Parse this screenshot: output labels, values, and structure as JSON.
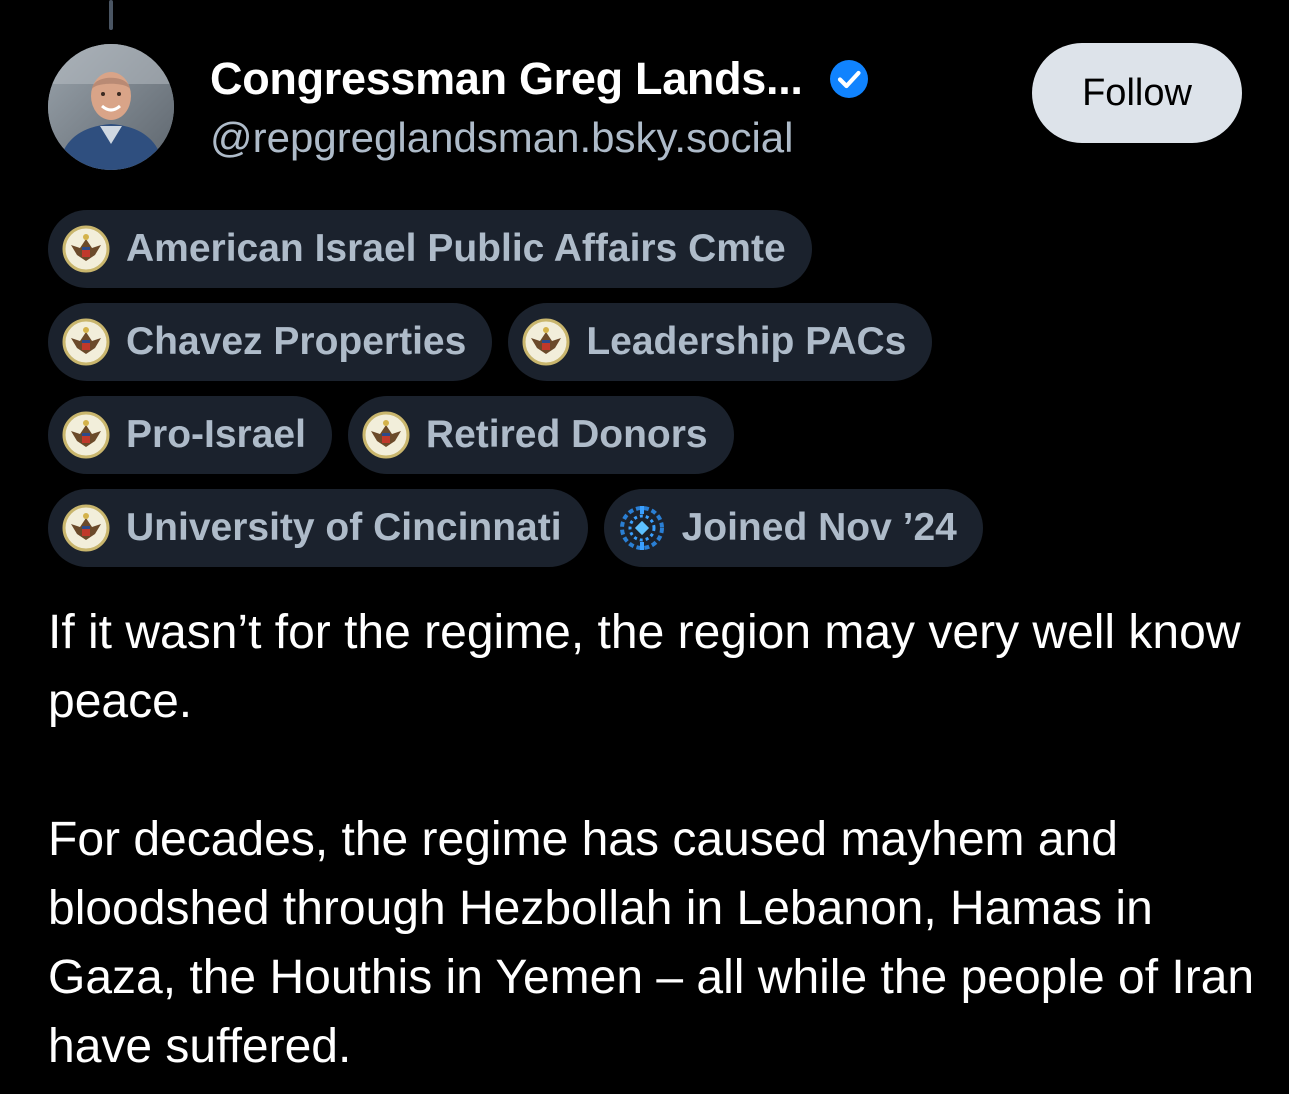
{
  "post": {
    "author": {
      "display_name": "Congressman Greg Lands...",
      "handle": "@repgreglandsman.bsky.social",
      "verified": true,
      "avatar_icon": "profile-photo",
      "verified_icon": "verified-check-icon"
    },
    "follow_label": "Follow",
    "badges": [
      {
        "label": "American Israel Public Affairs Cmte",
        "icon": "great-seal-icon"
      },
      {
        "label": "Chavez Properties",
        "icon": "great-seal-icon"
      },
      {
        "label": "Leadership PACs",
        "icon": "great-seal-icon"
      },
      {
        "label": "Pro-Israel",
        "icon": "great-seal-icon"
      },
      {
        "label": "Retired Donors",
        "icon": "great-seal-icon"
      },
      {
        "label": "University of Cincinnati",
        "icon": "great-seal-icon"
      },
      {
        "label": "Joined Nov ’24",
        "icon": "globe-icon"
      }
    ],
    "text": {
      "paragraph_1": "If it wasn’t for the regime, the region may very well know peace.",
      "paragraph_2": "For decades, the regime has caused mayhem and bloodshed through Hezbollah in Lebanon, Hamas in Gaza, the Houthis in Yemen – all while the people of Iran have suffered."
    }
  },
  "colors": {
    "background": "#000000",
    "text_primary": "#ffffff",
    "text_secondary": "#aebbc9",
    "badge_background": "#1b222d",
    "follow_button_background": "#dde3ea",
    "verified_blue": "#1083fe"
  }
}
